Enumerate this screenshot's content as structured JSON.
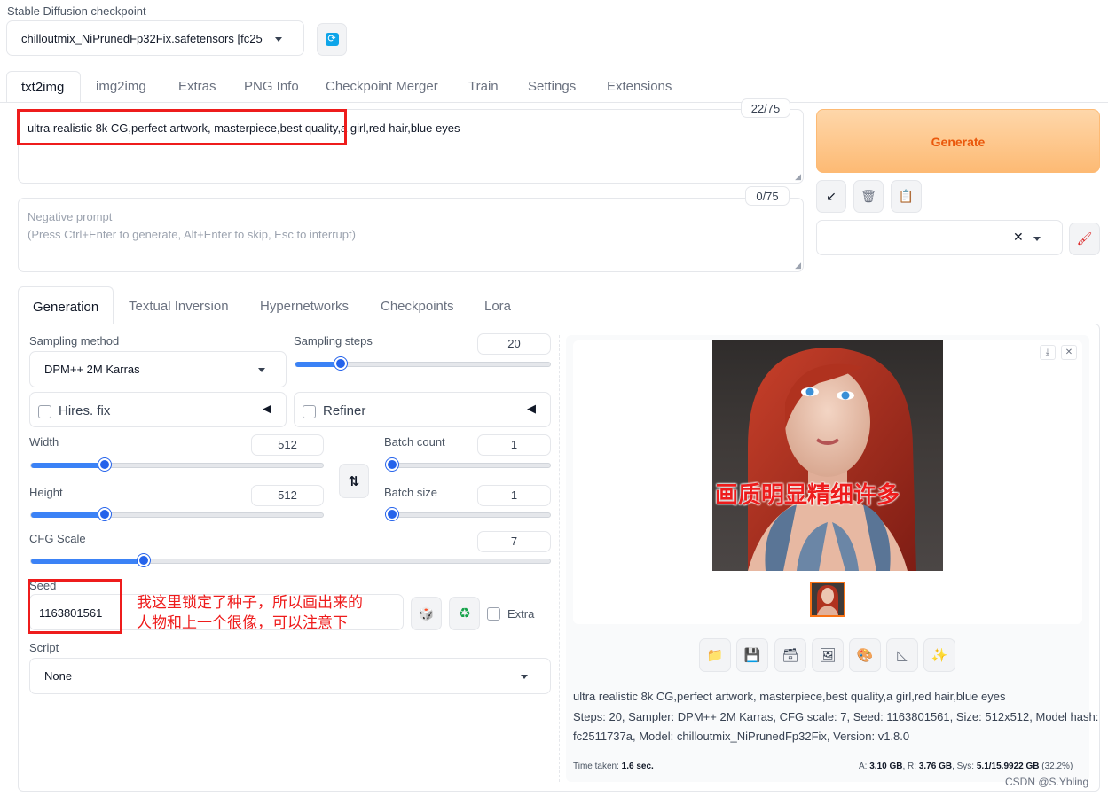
{
  "checkpoint": {
    "label": "Stable Diffusion checkpoint",
    "value": "chilloutmix_NiPrunedFp32Fix.safetensors [fc25"
  },
  "main_tabs": [
    "txt2img",
    "img2img",
    "Extras",
    "PNG Info",
    "Checkpoint Merger",
    "Train",
    "Settings",
    "Extensions"
  ],
  "prompt": {
    "value": "ultra realistic 8k CG,perfect artwork, masterpiece,best quality,a girl,red hair,blue eyes",
    "token_count": "22/75"
  },
  "negative_prompt": {
    "placeholder_line1": "Negative prompt",
    "placeholder_line2": "(Press Ctrl+Enter to generate, Alt+Enter to skip, Esc to interrupt)",
    "token_count": "0/75"
  },
  "generate_label": "Generate",
  "sub_tabs": [
    "Generation",
    "Textual Inversion",
    "Hypernetworks",
    "Checkpoints",
    "Lora"
  ],
  "sampling": {
    "method_label": "Sampling method",
    "method_value": "DPM++ 2M Karras",
    "steps_label": "Sampling steps",
    "steps_value": "20",
    "steps_fraction": 0.16
  },
  "hires_label": "Hires. fix",
  "refiner_label": "Refiner",
  "width": {
    "label": "Width",
    "value": "512",
    "fraction": 0.24
  },
  "height": {
    "label": "Height",
    "value": "512",
    "fraction": 0.24
  },
  "batch_count": {
    "label": "Batch count",
    "value": "1",
    "fraction": 0.0
  },
  "batch_size": {
    "label": "Batch size",
    "value": "1",
    "fraction": 0.0
  },
  "cfg": {
    "label": "CFG Scale",
    "value": "7",
    "fraction": 0.21
  },
  "seed": {
    "label": "Seed",
    "value": "1163801561",
    "extra_label": "Extra"
  },
  "script": {
    "label": "Script",
    "value": "None"
  },
  "annotations": {
    "seed_note_line1": "我这里锁定了种子，所以画出来的",
    "seed_note_line2": "人物和上一个很像，可以注意下",
    "image_note": "画质明显精细许多"
  },
  "output": {
    "caption_line1": "ultra realistic 8k CG,perfect artwork, masterpiece,best quality,a girl,red hair,blue eyes",
    "caption_line2": "Steps: 20, Sampler: DPM++ 2M Karras, CFG scale: 7, Seed: 1163801561, Size: 512x512, Model hash:",
    "caption_line3": "fc2511737a, Model: chilloutmix_NiPrunedFp32Fix, Version: v1.8.0",
    "time_label": "Time taken:",
    "time_value": "1.6 sec.",
    "mem_a_label": "A:",
    "mem_a_value": "3.10 GB",
    "mem_r_label": "R:",
    "mem_r_value": "3.76 GB",
    "mem_sys_label": "Sys:",
    "mem_sys_value": "5.1/15.9922 GB",
    "mem_sys_pct": "(32.2%)"
  },
  "watermark": "CSDN @S.Ybling",
  "colors": {
    "accent": "#2563eb",
    "generate_text": "#ea580c",
    "annotation_red": "#ee1c1c"
  }
}
